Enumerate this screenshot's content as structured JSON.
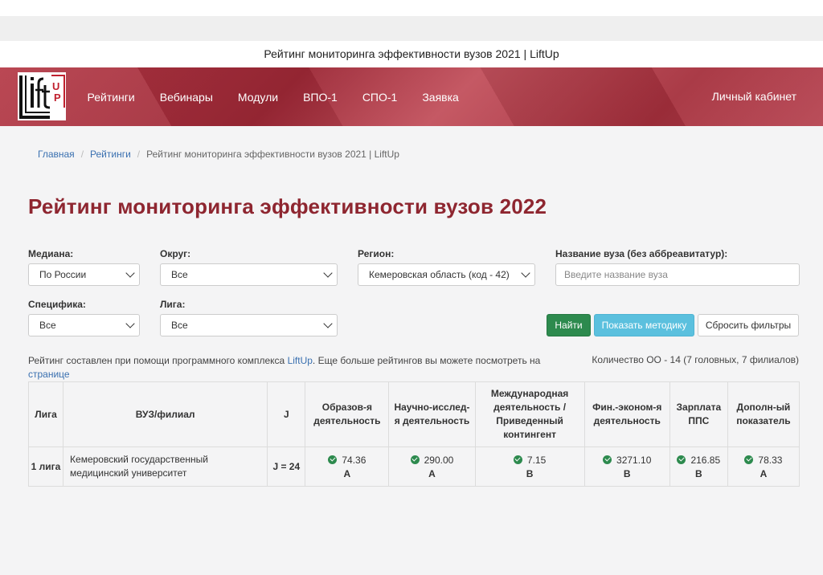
{
  "page": {
    "title": "Рейтинг мониторинга эффективности вузов 2021 | LiftUp"
  },
  "navbar": {
    "logo": {
      "text": "LiftUp"
    },
    "links": [
      "Рейтинги",
      "Вебинары",
      "Модули",
      "ВПО-1",
      "СПО-1",
      "Заявка"
    ],
    "account": "Личный кабинет"
  },
  "breadcrumb": {
    "home": "Главная",
    "ratings": "Рейтинги",
    "current": "Рейтинг мониторинга эффективности вузов 2021 | LiftUp"
  },
  "heading": "Рейтинг мониторинга эффективности вузов 2022",
  "filters": {
    "median": {
      "label": "Медиана:",
      "value": "По России"
    },
    "district": {
      "label": "Округ:",
      "value": "Все"
    },
    "region": {
      "label": "Регион:",
      "value": "Кемеровская область (код - 42)"
    },
    "name": {
      "label": "Название вуза (без аббреавитатур):",
      "placeholder": "Введите название вуза"
    },
    "specificity": {
      "label": "Специфика:",
      "value": "Все"
    },
    "league": {
      "label": "Лига:",
      "value": "Все"
    }
  },
  "buttons": {
    "find": "Найти",
    "method": "Показать методику",
    "reset": "Сбросить фильтры"
  },
  "info": {
    "text": "Рейтинг составлен при помощи программного комплекса ",
    "link": "LiftUp",
    "text2": ". Еще больше рейтингов вы можете посмотреть на ",
    "link2": "странице"
  },
  "count": "Количество ОО - 14 (7 головных, 7 филиалов)",
  "table": {
    "headers": [
      "Лига",
      "ВУЗ/филиал",
      "J",
      "Образов-я деятельность",
      "Научно-исслед-я деятельность",
      "Международная деятельность / Приведенный контингент",
      "Фин.-эконом-я деятельность",
      "Зарплата ППС",
      "Дополн-ый показатель"
    ],
    "rows": [
      {
        "league": "1 лига",
        "name": "Кемеровский государственный медицинский университет",
        "j": "J = 24",
        "metrics": [
          {
            "value": "74.36",
            "grade": "A"
          },
          {
            "value": "290.00",
            "grade": "A"
          },
          {
            "value": "7.15",
            "grade": "B"
          },
          {
            "value": "3271.10",
            "grade": "B"
          },
          {
            "value": "216.85",
            "grade": "B"
          },
          {
            "value": "78.33",
            "grade": "A"
          }
        ]
      }
    ]
  },
  "colors": {
    "brand": "#a52f3c",
    "heading": "#8e2630",
    "success": "#2d8a4e",
    "info": "#5bc0de",
    "link": "#3a70b0"
  }
}
